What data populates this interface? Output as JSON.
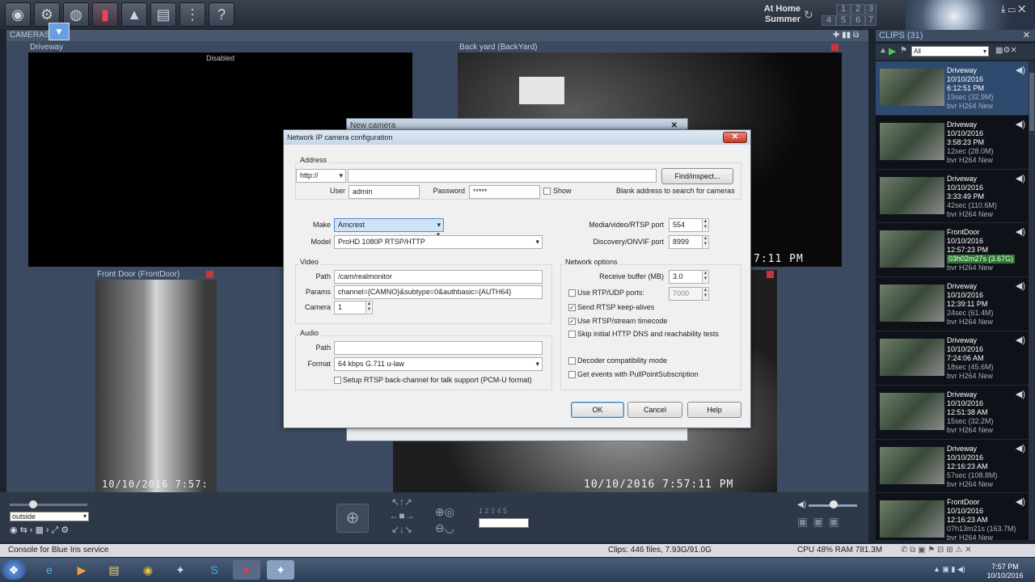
{
  "toolbar": {
    "profile_location": "At Home",
    "profile_schedule": "Summer",
    "profile_numbers": [
      "1",
      "2",
      "3",
      "4",
      "5",
      "6",
      "7"
    ]
  },
  "cameras_panel": {
    "header": "CAMERAS",
    "cams": [
      {
        "title": "Driveway",
        "status": "Disabled"
      },
      {
        "title": "Back yard (BackYard)",
        "timestamp": "7:11 PM"
      },
      {
        "title": "Front Door (FrontDoor)",
        "timestamp": "10/10/2016 7:57:"
      },
      {
        "title": "",
        "timestamp": "10/10/2016 7:57:11 PM"
      }
    ]
  },
  "controls": {
    "profile_select": "outside"
  },
  "clips_panel": {
    "header": "CLIPS",
    "count": "(31)",
    "filter": "All",
    "clips": [
      {
        "name": "Driveway",
        "date": "10/10/2016",
        "time": "6:12:51 PM",
        "size": "19sec (32.9M)",
        "codec": "bvr H264 New",
        "highlight": false,
        "selected": true
      },
      {
        "name": "Driveway",
        "date": "10/10/2016",
        "time": "3:58:23 PM",
        "size": "12sec (28.0M)",
        "codec": "bvr H264 New",
        "highlight": false,
        "selected": false
      },
      {
        "name": "Driveway",
        "date": "10/10/2016",
        "time": "3:33:49 PM",
        "size": "42sec (110.6M)",
        "codec": "bvr H264 New",
        "highlight": false,
        "selected": false
      },
      {
        "name": "FrontDoor",
        "date": "10/10/2016",
        "time": "12:57:23 PM",
        "size": "03h02m27s (3.67G)",
        "codec": "bvr H264 New",
        "highlight": true,
        "selected": false
      },
      {
        "name": "Driveway",
        "date": "10/10/2016",
        "time": "12:39:11 PM",
        "size": "24sec (61.4M)",
        "codec": "bvr H264 New",
        "highlight": false,
        "selected": false
      },
      {
        "name": "Driveway",
        "date": "10/10/2016",
        "time": "7:24:06 AM",
        "size": "18sec (45.6M)",
        "codec": "bvr H264 New",
        "highlight": false,
        "selected": false
      },
      {
        "name": "Driveway",
        "date": "10/10/2016",
        "time": "12:51:38 AM",
        "size": "15sec (32.2M)",
        "codec": "bvr H264 New",
        "highlight": false,
        "selected": false
      },
      {
        "name": "Driveway",
        "date": "10/10/2016",
        "time": "12:16:23 AM",
        "size": "57sec (108.8M)",
        "codec": "bvr H264 New",
        "highlight": false,
        "selected": false
      },
      {
        "name": "FrontDoor",
        "date": "10/10/2016",
        "time": "12:16:23 AM",
        "size": "07h13m21s (163.7M)",
        "codec": "bvr H264 New",
        "highlight": false,
        "selected": false
      }
    ]
  },
  "status_bar": {
    "left": "Console for Blue Iris service",
    "clips": "Clips: 446 files, 7.93G/91.0G",
    "resources": "CPU 48% RAM 781.3M"
  },
  "taskbar": {
    "time": "7:57 PM",
    "date": "10/10/2016"
  },
  "new_camera_window": {
    "title": "New camera"
  },
  "dialog": {
    "title": "Network IP camera configuration",
    "address_group": "Address",
    "protocol": "http://",
    "address_value": "",
    "find_button": "Find/inspect...",
    "user_label": "User",
    "user_value": "admin",
    "password_label": "Password",
    "password_value": "*****",
    "show_label": "Show",
    "hint": "Blank address to search for cameras",
    "make_label": "Make",
    "make_value": "Amcrest",
    "model_label": "Model",
    "model_value": "ProHD 1080P RTSP/HTTP",
    "media_port_label": "Media/video/RTSP port",
    "media_port_value": "554",
    "onvif_port_label": "Discovery/ONVIF port",
    "onvif_port_value": "8999",
    "video_group": "Video",
    "path_label": "Path",
    "path_value": "/cam/realmonitor",
    "params_label": "Params",
    "params_value": "channel={CAMNO}&subtype=0&authbasic={AUTH64}",
    "camera_label": "Camera",
    "camera_value": "1",
    "audio_group": "Audio",
    "audio_path_label": "Path",
    "audio_path_value": "",
    "format_label": "Format",
    "format_value": "64 kbps G.711 u-law",
    "backchannel_label": "Setup RTSP back-channel for talk support (PCM-U format)",
    "network_group": "Network options",
    "buffer_label": "Receive buffer (MB)",
    "buffer_value": "3.0",
    "rtp_label": "Use RTP/UDP ports:",
    "rtp_value": "7000",
    "keepalive_label": "Send RTSP keep-alives",
    "timecode_label": "Use RTSP/stream timecode",
    "skip_dns_label": "Skip initial HTTP DNS and reachability tests",
    "decoder_label": "Decoder compatibility mode",
    "pullpoint_label": "Get events with PullPointSubscription",
    "ok": "OK",
    "cancel": "Cancel",
    "help": "Help"
  }
}
